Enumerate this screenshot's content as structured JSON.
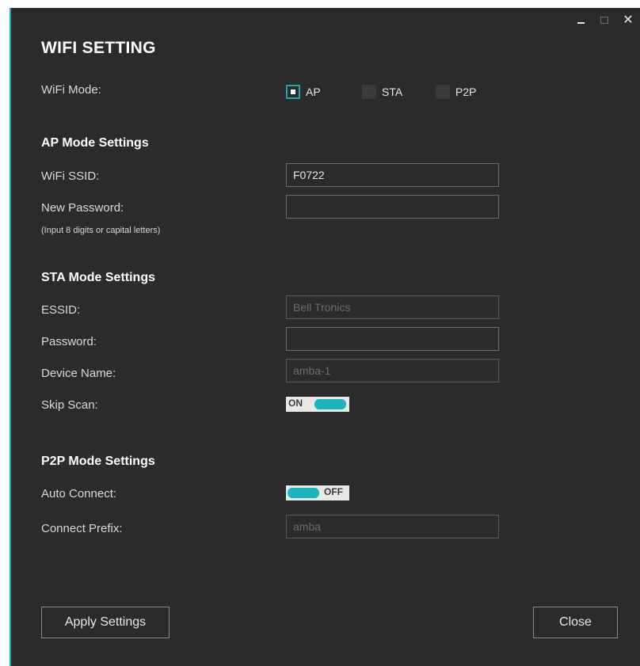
{
  "window": {
    "title": "WIFI SETTING"
  },
  "wifi_mode": {
    "label": "WiFi Mode:",
    "options": [
      {
        "label": "AP",
        "checked": true
      },
      {
        "label": "STA",
        "checked": false
      },
      {
        "label": "P2P",
        "checked": false
      }
    ]
  },
  "ap": {
    "section_title": "AP Mode Settings",
    "ssid_label": "WiFi SSID:",
    "ssid_value": "F0722",
    "password_label": "New Password:",
    "password_hint": "(Input 8 digits or capital letters)",
    "password_value": ""
  },
  "sta": {
    "section_title": "STA Mode Settings",
    "essid_label": "ESSID:",
    "essid_value": "Bell Tronics",
    "password_label": "Password:",
    "password_value": "",
    "device_name_label": "Device Name:",
    "device_name_value": "amba-1",
    "skip_scan_label": "Skip Scan:",
    "skip_scan_state": "ON"
  },
  "p2p": {
    "section_title": "P2P Mode Settings",
    "auto_connect_label": "Auto Connect:",
    "auto_connect_state": "OFF",
    "prefix_label": "Connect Prefix:",
    "prefix_value": "amba"
  },
  "buttons": {
    "apply": "Apply Settings",
    "close": "Close"
  },
  "colors": {
    "accent": "#1ba7b2",
    "background": "#2b2b2b",
    "toggle_knob": "#1bb3be"
  }
}
